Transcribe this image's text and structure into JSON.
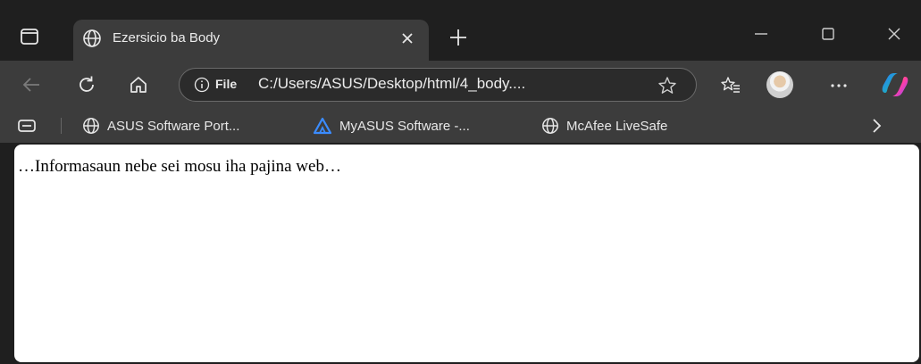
{
  "tab": {
    "title": "Ezersicio ba Body",
    "favicon": "globe-icon"
  },
  "address_bar": {
    "scheme_label": "File",
    "url": "C:/Users/ASUS/Desktop/html/4_body...."
  },
  "bookmarks": [
    {
      "label": "ASUS Software Port...",
      "icon": "globe-icon"
    },
    {
      "label": "MyASUS Software -...",
      "icon": "myasus-logo-icon"
    },
    {
      "label": "McAfee LiveSafe",
      "icon": "globe-icon"
    }
  ],
  "page": {
    "body_text": "…Informasaun nebe sei mosu iha pajina web…"
  },
  "colors": {
    "titlebar_bg": "#1f1f1f",
    "toolbar_bg": "#3c3c3c",
    "content_bg": "#ffffff",
    "myasus_accent": "#3b8cff"
  }
}
